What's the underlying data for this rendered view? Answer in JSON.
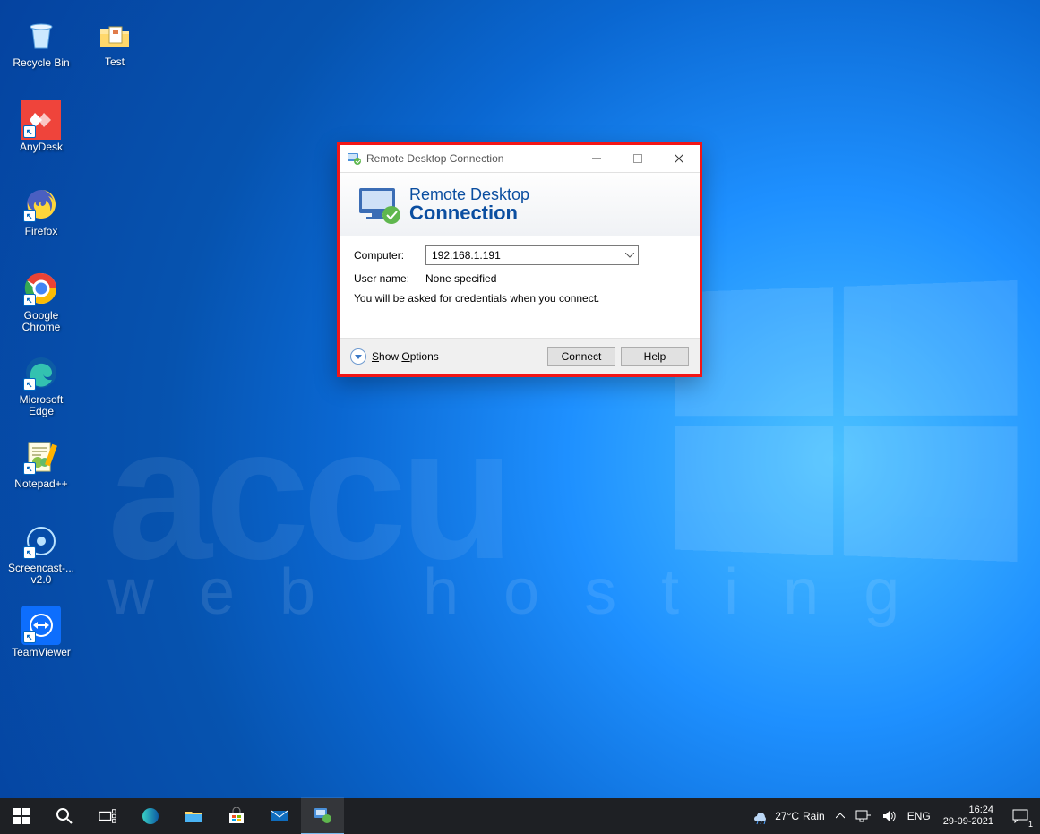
{
  "desktop_icons": {
    "recycle_bin": "Recycle Bin",
    "test": "Test",
    "anydesk": "AnyDesk",
    "firefox": "Firefox",
    "chrome": "Google Chrome",
    "edge": "Microsoft Edge",
    "notepadpp": "Notepad++",
    "screencast": "Screencast-... v2.0",
    "teamviewer": "TeamViewer"
  },
  "dialog": {
    "title": "Remote Desktop Connection",
    "banner_line1": "Remote Desktop",
    "banner_line2": "Connection",
    "computer_label": "Computer:",
    "computer_value": "192.168.1.191",
    "username_label": "User name:",
    "username_value": "None specified",
    "hint": "You will be asked for credentials when you connect.",
    "show_options": "Show Options",
    "connect": "Connect",
    "help": "Help"
  },
  "taskbar": {
    "weather_temp": "27°C",
    "weather_desc": "Rain",
    "lang": "ENG",
    "time": "16:24",
    "date": "29-09-2021",
    "notif_count": "1"
  },
  "watermark": {
    "line1": "accu",
    "line2": "web hosting"
  }
}
